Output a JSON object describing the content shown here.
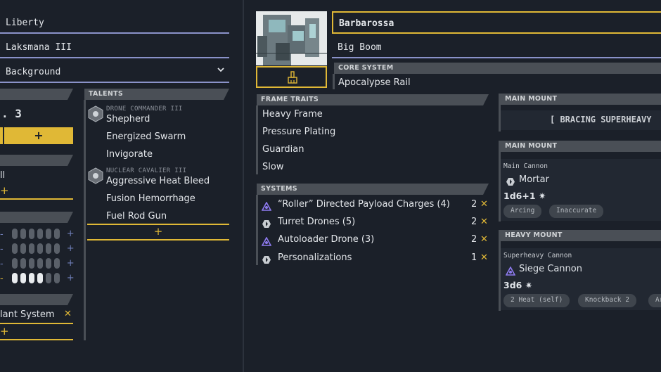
{
  "left": {
    "fields": {
      "callsign": "Liberty",
      "name": "Laksmana III",
      "background": "Background"
    },
    "stat_value": ". 3",
    "skill_partial": "ll",
    "core_bonus_partial": "lant System"
  },
  "talents": {
    "header": "TALENTS",
    "groups": [
      {
        "name": "DRONE COMMANDER III",
        "ranks": [
          "Shepherd",
          "Energized Swarm",
          "Invigorate"
        ]
      },
      {
        "name": "NUCLEAR CAVALIER III",
        "ranks": [
          "Aggressive Heat Bleed",
          "Fusion Hemorrhage",
          "Fuel Rod Gun"
        ]
      }
    ],
    "add_label": "+"
  },
  "mech": {
    "name": "Barbarossa",
    "frame": "Big Boom",
    "core_system_label": "CORE SYSTEM",
    "core_system": "Apocalypse Rail",
    "frame_traits_label": "FRAME TRAITS",
    "frame_traits": [
      "Heavy Frame",
      "Pressure Plating",
      "Guardian",
      "Slow"
    ],
    "systems_label": "SYSTEMS",
    "systems": [
      {
        "name": "“Roller” Directed Payload Charges (4)",
        "sp": "2",
        "icon": "drone-icon-purple"
      },
      {
        "name": "Turret Drones (5)",
        "sp": "2",
        "icon": "hex-icon"
      },
      {
        "name": "Autoloader Drone (3)",
        "sp": "2",
        "icon": "drone-icon-purple"
      },
      {
        "name": "Personalizations",
        "sp": "1",
        "icon": "hex-icon"
      }
    ]
  },
  "mounts": {
    "m1": {
      "label": "MAIN MOUNT",
      "text": "[ BRACING SUPERHEAVY"
    },
    "m2": {
      "label": "MAIN MOUNT",
      "type": "Main Cannon",
      "weapon": "Mortar",
      "damage": "1d6+1",
      "tags": [
        "Arcing",
        "Inaccurate"
      ]
    },
    "m3": {
      "label": "HEAVY MOUNT",
      "type": "Superheavy Cannon",
      "weapon": "Siege Cannon",
      "damage": "3d6",
      "tags": [
        "2 Heat (self)",
        "Knockback 2",
        "Arc"
      ]
    }
  }
}
